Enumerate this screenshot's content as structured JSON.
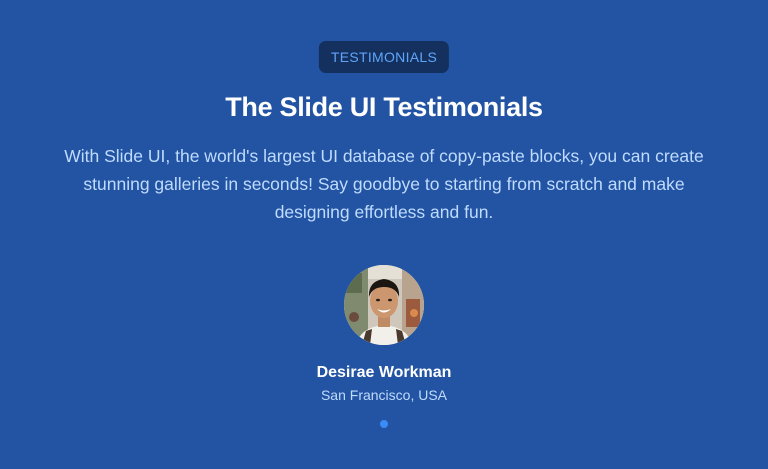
{
  "header": {
    "badge": "TESTIMONIALS",
    "title": "The Slide UI Testimonials",
    "description": "With Slide UI, the world's largest UI database of copy-paste blocks, you can create stunning galleries in seconds! Say goodbye to starting from scratch and make designing effortless and fun."
  },
  "testimonial": {
    "name": "Desirae Workman",
    "location": "San Francisco, USA"
  },
  "pagination": {
    "total": 1,
    "active": 1
  },
  "colors": {
    "background": "#2354a3",
    "badge_background": "#13305e",
    "badge_text": "#60a5fa",
    "heading": "#ffffff",
    "body_text": "#bfdbfe",
    "pagination_dot": "#3b8df5"
  }
}
